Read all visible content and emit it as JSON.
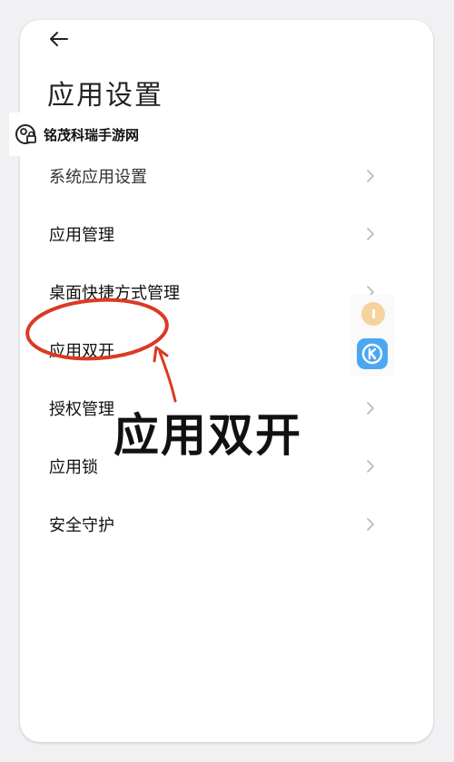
{
  "header": {
    "back_icon": "arrow-left-icon",
    "title": "应用设置"
  },
  "watermark": {
    "icon": "camera-lock-icon",
    "text": "铭茂科瑞手游网"
  },
  "settings": {
    "items": [
      {
        "label": "系统应用设置"
      },
      {
        "label": "应用管理"
      },
      {
        "label": "桌面快捷方式管理"
      },
      {
        "label": "应用双开"
      },
      {
        "label": "授权管理"
      },
      {
        "label": "应用锁"
      },
      {
        "label": "安全守护"
      }
    ],
    "chevron_icon": "chevron-right-icon"
  },
  "annotation": {
    "text": "应用双开",
    "color": "#d93a24"
  },
  "floating_widget": {
    "icons": [
      "info-badge-icon",
      "k-app-icon"
    ],
    "accent": "#4ba7f2"
  }
}
